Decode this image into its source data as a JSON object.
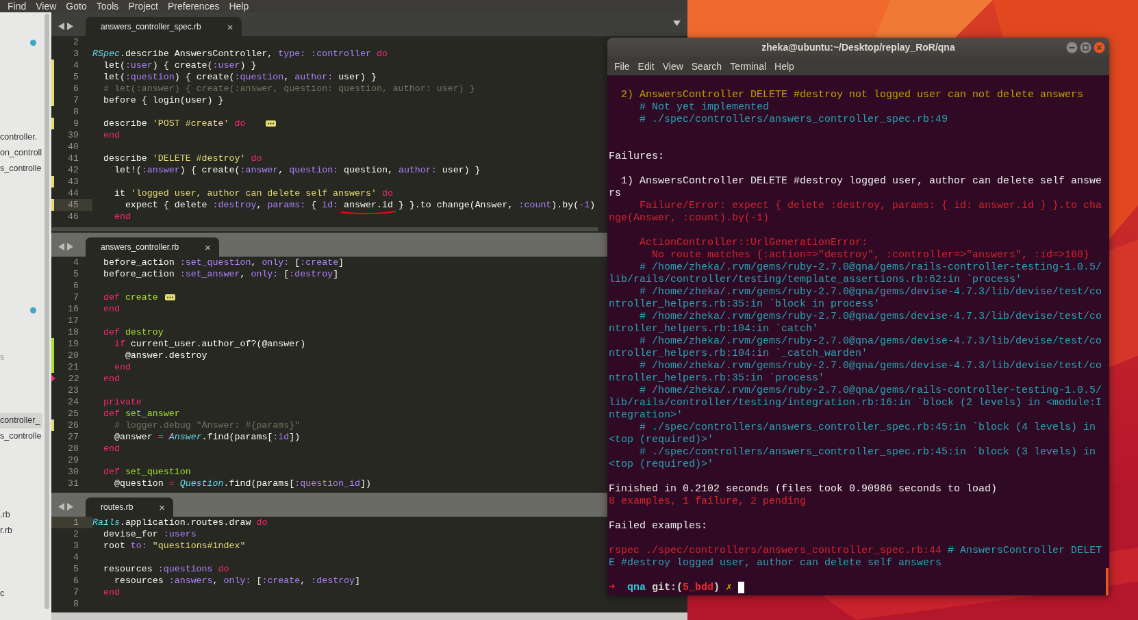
{
  "menu": [
    "Find",
    "View",
    "Goto",
    "Tools",
    "Project",
    "Preferences",
    "Help"
  ],
  "sidebar": {
    "items": [
      {
        "kind": "dot"
      },
      {
        "kind": "file",
        "label": "controller.",
        "selected": false,
        "dimmed": false
      },
      {
        "kind": "file",
        "label": "on_controll",
        "selected": false,
        "dimmed": false
      },
      {
        "kind": "file",
        "label": "s_controlle",
        "selected": false,
        "dimmed": false
      },
      {
        "kind": "dot"
      },
      {
        "kind": "file",
        "label": "s",
        "selected": false,
        "dimmed": true
      },
      {
        "kind": "file",
        "label": "controller_",
        "selected": true,
        "dimmed": false
      },
      {
        "kind": "file",
        "label": "s_controlle",
        "selected": false,
        "dimmed": false
      },
      {
        "kind": "file",
        "label": ".rb",
        "selected": false,
        "dimmed": false
      },
      {
        "kind": "file",
        "label": "r.rb",
        "selected": false,
        "dimmed": false
      },
      {
        "kind": "file",
        "label": "c",
        "selected": false,
        "dimmed": false
      }
    ]
  },
  "panes": [
    {
      "focused": true,
      "dropdown": true,
      "tab": {
        "label": "answers_controller_spec.rb",
        "close": "×",
        "selected": true
      },
      "lines": [
        {
          "n": "2",
          "current": false
        },
        {
          "n": "3",
          "current": false,
          "tokens": [
            {
              "text": "RSpec",
              "kind": "class"
            },
            {
              "text": ".describe AnswersController, ",
              "kind": "plain"
            },
            {
              "text": "type:",
              "kind": "symbol"
            },
            {
              "text": " :controller",
              "kind": "symbol"
            },
            {
              "text": " do",
              "kind": "keyword"
            }
          ]
        },
        {
          "n": "4",
          "current": false,
          "kind": "modified",
          "tokens": [
            {
              "text": "  let(",
              "kind": "plain"
            },
            {
              "text": ":user",
              "kind": "symbol"
            },
            {
              "text": ") { create(",
              "kind": "plain"
            },
            {
              "text": ":user",
              "kind": "symbol"
            },
            {
              "text": ") }",
              "kind": "plain"
            }
          ]
        },
        {
          "n": "5",
          "current": false,
          "kind": "modified",
          "tokens": [
            {
              "text": "  let(",
              "kind": "plain"
            },
            {
              "text": ":question",
              "kind": "symbol"
            },
            {
              "text": ") { create(",
              "kind": "plain"
            },
            {
              "text": ":question",
              "kind": "symbol"
            },
            {
              "text": ", ",
              "kind": "plain"
            },
            {
              "text": "author:",
              "kind": "symbol"
            },
            {
              "text": " user) }",
              "kind": "plain"
            }
          ]
        },
        {
          "n": "6",
          "current": false,
          "kind": "modified",
          "tokens": [
            {
              "text": "  # let(:answer) { create(:answer, question: question, author: user) }",
              "kind": "comment"
            }
          ]
        },
        {
          "n": "7",
          "current": false,
          "kind": "modified",
          "tokens": [
            {
              "text": "  before { login(user) }",
              "kind": "plain"
            }
          ]
        },
        {
          "n": "8",
          "current": false
        },
        {
          "n": "9",
          "current": false,
          "kind": "modified",
          "fold": true,
          "tokens": [
            {
              "text": "  describe ",
              "kind": "plain"
            },
            {
              "text": "'POST #create'",
              "kind": "string"
            },
            {
              "text": " do",
              "kind": "keyword"
            }
          ]
        },
        {
          "n": "39",
          "current": false,
          "tokens": [
            {
              "text": "  end",
              "kind": "keyword"
            }
          ]
        },
        {
          "n": "40",
          "current": false
        },
        {
          "n": "41",
          "current": false,
          "tokens": [
            {
              "text": "  describe ",
              "kind": "plain"
            },
            {
              "text": "'DELETE #destroy'",
              "kind": "string"
            },
            {
              "text": " do",
              "kind": "keyword"
            }
          ]
        },
        {
          "n": "42",
          "current": false,
          "tokens": [
            {
              "text": "    let!(",
              "kind": "plain"
            },
            {
              "text": ":answer",
              "kind": "symbol"
            },
            {
              "text": ") { create(",
              "kind": "plain"
            },
            {
              "text": ":answer",
              "kind": "symbol"
            },
            {
              "text": ", ",
              "kind": "plain"
            },
            {
              "text": "question:",
              "kind": "symbol"
            },
            {
              "text": " question, ",
              "kind": "plain"
            },
            {
              "text": "author:",
              "kind": "symbol"
            },
            {
              "text": " user) }",
              "kind": "plain"
            }
          ]
        },
        {
          "n": "43",
          "current": false,
          "kind": "modified"
        },
        {
          "n": "44",
          "current": false,
          "tokens": [
            {
              "text": "    it ",
              "kind": "plain"
            },
            {
              "text": "'logged user, author can delete self answers'",
              "kind": "string"
            },
            {
              "text": " do",
              "kind": "keyword"
            }
          ]
        },
        {
          "n": "45",
          "current": true,
          "kind": "modified",
          "tokens": [
            {
              "text": "      expect { delete ",
              "kind": "plain"
            },
            {
              "text": ":destroy",
              "kind": "symbol"
            },
            {
              "text": ", ",
              "kind": "plain"
            },
            {
              "text": "params:",
              "kind": "symbol"
            },
            {
              "text": " { ",
              "kind": "plain"
            },
            {
              "text": "id: ",
              "kind": "symbol"
            },
            {
              "text": "answer.id",
              "kind": "annotated"
            },
            {
              "text": " } }.to change(Answer, ",
              "kind": "plain"
            },
            {
              "text": ":count",
              "kind": "symbol"
            },
            {
              "text": ").by(",
              "kind": "plain"
            },
            {
              "text": "-1",
              "kind": "symbol"
            },
            {
              "text": ")",
              "kind": "plain"
            }
          ]
        },
        {
          "n": "46",
          "current": false,
          "tokens": [
            {
              "text": "    end",
              "kind": "keyword"
            }
          ]
        }
      ]
    },
    {
      "focused": false,
      "dropdown": false,
      "tab": {
        "label": "answers_controller.rb",
        "close": "×",
        "selected": true
      },
      "lines": [
        {
          "n": "4",
          "current": false,
          "tokens": [
            {
              "text": "  before_action ",
              "kind": "plain"
            },
            {
              "text": ":set_question",
              "kind": "symbol"
            },
            {
              "text": ", ",
              "kind": "plain"
            },
            {
              "text": "only:",
              "kind": "symbol"
            },
            {
              "text": " [",
              "kind": "plain"
            },
            {
              "text": ":create",
              "kind": "symbol"
            },
            {
              "text": "]",
              "kind": "plain"
            }
          ]
        },
        {
          "n": "5",
          "current": false,
          "tokens": [
            {
              "text": "  before_action ",
              "kind": "plain"
            },
            {
              "text": ":set_answer",
              "kind": "symbol"
            },
            {
              "text": ", ",
              "kind": "plain"
            },
            {
              "text": "only:",
              "kind": "symbol"
            },
            {
              "text": " [",
              "kind": "plain"
            },
            {
              "text": ":destroy",
              "kind": "symbol"
            },
            {
              "text": "]",
              "kind": "plain"
            }
          ]
        },
        {
          "n": "6",
          "current": false
        },
        {
          "n": "7",
          "current": false,
          "fold": true,
          "tokens": [
            {
              "text": "  def",
              "kind": "keyword"
            },
            {
              "text": " create",
              "kind": "function"
            }
          ]
        },
        {
          "n": "16",
          "current": false,
          "tokens": [
            {
              "text": "  end",
              "kind": "keyword"
            }
          ]
        },
        {
          "n": "17",
          "current": false
        },
        {
          "n": "18",
          "current": false,
          "tokens": [
            {
              "text": "  def",
              "kind": "keyword"
            },
            {
              "text": " destroy",
              "kind": "function"
            }
          ]
        },
        {
          "n": "19",
          "current": false,
          "kind": "added",
          "tokens": [
            {
              "text": "    if",
              "kind": "keyword"
            },
            {
              "text": " current_user.author_of?(@answer)",
              "kind": "plain"
            }
          ]
        },
        {
          "n": "20",
          "current": false,
          "kind": "added",
          "tokens": [
            {
              "text": "      @answer.destroy",
              "kind": "plain"
            }
          ]
        },
        {
          "n": "21",
          "current": false,
          "kind": "added",
          "tokens": [
            {
              "text": "    end",
              "kind": "keyword"
            }
          ]
        },
        {
          "n": "22",
          "current": false,
          "kind": "deleted",
          "tokens": [
            {
              "text": "  end",
              "kind": "keyword"
            }
          ]
        },
        {
          "n": "23",
          "current": false
        },
        {
          "n": "24",
          "current": false,
          "tokens": [
            {
              "text": "  private",
              "kind": "keyword"
            }
          ]
        },
        {
          "n": "25",
          "current": false,
          "tokens": [
            {
              "text": "  def",
              "kind": "keyword"
            },
            {
              "text": " set_answer",
              "kind": "function"
            }
          ]
        },
        {
          "n": "26",
          "current": false,
          "kind": "modified",
          "tokens": [
            {
              "text": "    # logger.debug \"Answer: #{params}\"",
              "kind": "comment"
            }
          ]
        },
        {
          "n": "27",
          "current": false,
          "tokens": [
            {
              "text": "    @answer ",
              "kind": "plain"
            },
            {
              "text": "=",
              "kind": "keyword"
            },
            {
              "text": " Answer",
              "kind": "class"
            },
            {
              "text": ".find(params[",
              "kind": "plain"
            },
            {
              "text": ":id",
              "kind": "symbol"
            },
            {
              "text": "])",
              "kind": "plain"
            }
          ]
        },
        {
          "n": "28",
          "current": false,
          "tokens": [
            {
              "text": "  end",
              "kind": "keyword"
            }
          ]
        },
        {
          "n": "29",
          "current": false
        },
        {
          "n": "30",
          "current": false,
          "tokens": [
            {
              "text": "  def",
              "kind": "keyword"
            },
            {
              "text": " set_question",
              "kind": "function"
            }
          ]
        },
        {
          "n": "31",
          "current": false,
          "tokens": [
            {
              "text": "    @question ",
              "kind": "plain"
            },
            {
              "text": "=",
              "kind": "keyword"
            },
            {
              "text": " Question",
              "kind": "class"
            },
            {
              "text": ".find(params[",
              "kind": "plain"
            },
            {
              "text": ":question_id",
              "kind": "symbol"
            },
            {
              "text": "])",
              "kind": "plain"
            }
          ]
        }
      ]
    },
    {
      "focused": false,
      "dropdown": false,
      "tab": {
        "label": "routes.rb",
        "close": "×",
        "selected": true
      },
      "lines": [
        {
          "n": "1",
          "current": true,
          "tokens": [
            {
              "text": "Rails",
              "kind": "class"
            },
            {
              "text": ".application.routes.draw ",
              "kind": "plain"
            },
            {
              "text": "do",
              "kind": "keyword"
            }
          ]
        },
        {
          "n": "2",
          "current": false,
          "tokens": [
            {
              "text": "  devise_for ",
              "kind": "plain"
            },
            {
              "text": ":users",
              "kind": "symbol"
            }
          ]
        },
        {
          "n": "3",
          "current": false,
          "tokens": [
            {
              "text": "  root ",
              "kind": "plain"
            },
            {
              "text": "to:",
              "kind": "symbol"
            },
            {
              "text": " \"questions#index\"",
              "kind": "string"
            }
          ]
        },
        {
          "n": "4",
          "current": false
        },
        {
          "n": "5",
          "current": false,
          "tokens": [
            {
              "text": "  resources ",
              "kind": "plain"
            },
            {
              "text": ":questions",
              "kind": "symbol"
            },
            {
              "text": " do",
              "kind": "keyword"
            }
          ]
        },
        {
          "n": "6",
          "current": false,
          "tokens": [
            {
              "text": "    resources ",
              "kind": "plain"
            },
            {
              "text": ":answers",
              "kind": "symbol"
            },
            {
              "text": ", ",
              "kind": "plain"
            },
            {
              "text": "only:",
              "kind": "symbol"
            },
            {
              "text": " [",
              "kind": "plain"
            },
            {
              "text": ":create",
              "kind": "symbol"
            },
            {
              "text": ", ",
              "kind": "plain"
            },
            {
              "text": ":destroy",
              "kind": "symbol"
            },
            {
              "text": "]",
              "kind": "plain"
            }
          ]
        },
        {
          "n": "7",
          "current": false,
          "tokens": [
            {
              "text": "  end",
              "kind": "keyword"
            }
          ]
        },
        {
          "n": "8",
          "current": false
        }
      ]
    }
  ],
  "terminal": {
    "title": "zheka@ubuntu:~/Desktop/replay_RoR/qna",
    "menu": [
      "File",
      "Edit",
      "View",
      "Search",
      "Terminal",
      "Help"
    ],
    "cursor": true,
    "blocks": [
      {
        "kind": "pending",
        "lines": [
          [
            {
              "text": "  2) AnswersController DELETE #destroy not logged user can not delete answers",
              "kind": "yellow"
            }
          ],
          [
            {
              "text": "     # Not yet implemented",
              "kind": "cyan"
            }
          ],
          [
            {
              "text": "     # ./spec/controllers/answers_controller_spec.rb:49",
              "kind": "cyan"
            }
          ]
        ]
      },
      {
        "kind": "heading",
        "lines": [
          [
            {
              "text": "Failures:",
              "kind": "white"
            }
          ]
        ]
      },
      {
        "kind": "failure",
        "lines": [
          [
            {
              "text": "  1) AnswersController DELETE #destroy logged user, author can delete self answe",
              "kind": "white"
            }
          ],
          [
            {
              "text": "rs",
              "kind": "white"
            }
          ],
          [
            {
              "text": "     Failure/Error: expect { delete :destroy, params: { id: answer.id } }.to cha",
              "kind": "red"
            }
          ],
          [
            {
              "text": "nge(Answer, :count).by(-1)",
              "kind": "red"
            }
          ]
        ]
      },
      {
        "kind": "trace",
        "lines": [
          [
            {
              "text": "     ActionController::UrlGenerationError:",
              "kind": "red"
            }
          ],
          [
            {
              "text": "       No route matches {:action=>\"destroy\", :controller=>\"answers\", :id=>160}",
              "kind": "red"
            }
          ],
          [
            {
              "text": "     # /home/zheka/.rvm/gems/ruby-2.7.0@qna/gems/rails-controller-testing-1.0.5/",
              "kind": "cyan"
            }
          ],
          [
            {
              "text": "lib/rails/controller/testing/template_assertions.rb:62:in `process'",
              "kind": "cyan"
            }
          ],
          [
            {
              "text": "     # /home/zheka/.rvm/gems/ruby-2.7.0@qna/gems/devise-4.7.3/lib/devise/test/co",
              "kind": "cyan"
            }
          ],
          [
            {
              "text": "ntroller_helpers.rb:35:in `block in process'",
              "kind": "cyan"
            }
          ],
          [
            {
              "text": "     # /home/zheka/.rvm/gems/ruby-2.7.0@qna/gems/devise-4.7.3/lib/devise/test/co",
              "kind": "cyan"
            }
          ],
          [
            {
              "text": "ntroller_helpers.rb:104:in `catch'",
              "kind": "cyan"
            }
          ],
          [
            {
              "text": "     # /home/zheka/.rvm/gems/ruby-2.7.0@qna/gems/devise-4.7.3/lib/devise/test/co",
              "kind": "cyan"
            }
          ],
          [
            {
              "text": "ntroller_helpers.rb:104:in `_catch_warden'",
              "kind": "cyan"
            }
          ],
          [
            {
              "text": "     # /home/zheka/.rvm/gems/ruby-2.7.0@qna/gems/devise-4.7.3/lib/devise/test/co",
              "kind": "cyan"
            }
          ],
          [
            {
              "text": "ntroller_helpers.rb:35:in `process'",
              "kind": "cyan"
            }
          ],
          [
            {
              "text": "     # /home/zheka/.rvm/gems/ruby-2.7.0@qna/gems/rails-controller-testing-1.0.5/",
              "kind": "cyan"
            }
          ],
          [
            {
              "text": "lib/rails/controller/testing/integration.rb:16:in `block (2 levels) in <module:I",
              "kind": "cyan"
            }
          ],
          [
            {
              "text": "ntegration>'",
              "kind": "cyan"
            }
          ],
          [
            {
              "text": "     # ./spec/controllers/answers_controller_spec.rb:45:in `block (4 levels) in",
              "kind": "cyan"
            }
          ],
          [
            {
              "text": "<top (required)>'",
              "kind": "cyan"
            }
          ],
          [
            {
              "text": "     # ./spec/controllers/answers_controller_spec.rb:45:in `block (3 levels) in",
              "kind": "cyan"
            }
          ],
          [
            {
              "text": "<top (required)>'",
              "kind": "cyan"
            }
          ]
        ]
      },
      {
        "kind": "summary",
        "lines": [
          [
            {
              "text": "Finished in 0.2102 seconds (files took 0.90986 seconds to load)",
              "kind": "white"
            }
          ],
          [
            {
              "text": "8 examples, 1 failure, 2 pending",
              "kind": "red"
            }
          ]
        ]
      },
      {
        "kind": "heading-near",
        "lines": [
          [
            {
              "text": "Failed examples:",
              "kind": "white"
            }
          ]
        ]
      },
      {
        "kind": "rerun",
        "lines": [
          [
            {
              "text": "rspec ./spec/controllers/answers_controller_spec.rb:44",
              "kind": "red"
            },
            {
              "text": " # AnswersController DELET",
              "kind": "cyan"
            }
          ],
          [
            {
              "text": "E #destroy logged user, author can delete self answers",
              "kind": "cyan"
            }
          ]
        ]
      },
      {
        "kind": "prompt",
        "lines": [
          [
            {
              "text": "➜ ",
              "kind": "red-bold"
            },
            {
              "text": " qna ",
              "kind": "cyan-bold"
            },
            {
              "text": "git:(",
              "kind": "white-bold"
            },
            {
              "text": "5_bdd",
              "kind": "red-bold"
            },
            {
              "text": ") ",
              "kind": "white-bold"
            },
            {
              "text": "✗ ",
              "kind": "yellow"
            }
          ]
        ]
      }
    ]
  }
}
